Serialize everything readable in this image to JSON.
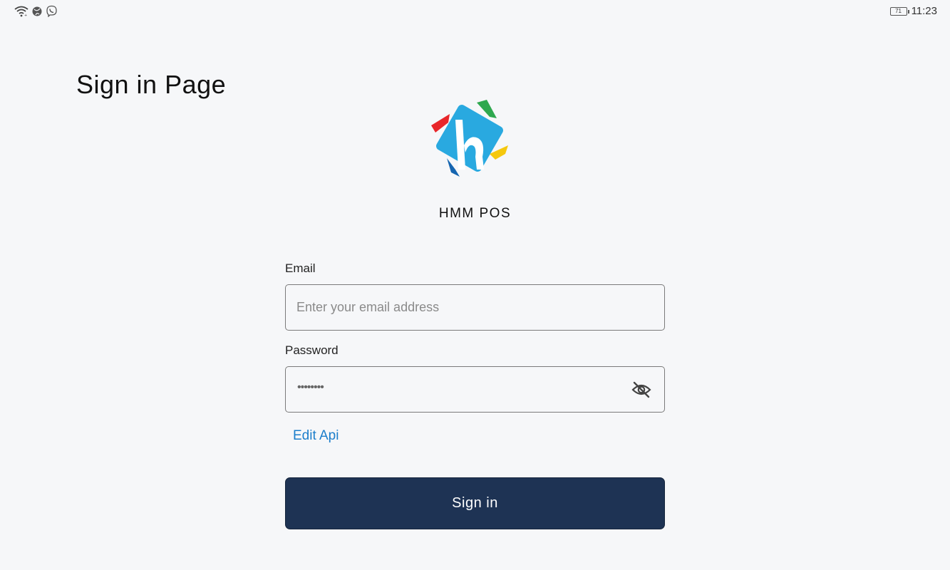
{
  "status_bar": {
    "left_icons": [
      "wifi-icon",
      "globe-icon",
      "viber-icon"
    ],
    "battery_level": "71",
    "time": "11:23"
  },
  "page": {
    "title": "Sign in Page"
  },
  "brand": {
    "logo_icon": "hmm-pos-logo",
    "app_name": "HMM POS",
    "colors": {
      "logo_blue": "#29a9e0",
      "logo_red": "#e8262a",
      "logo_green": "#2fa84f",
      "logo_yellow": "#f5c80e",
      "logo_dark_blue": "#1565b0"
    }
  },
  "form": {
    "email": {
      "label": "Email",
      "placeholder": "Enter your email address",
      "value": ""
    },
    "password": {
      "label": "Password",
      "masked_value": "••••••••",
      "toggle_icon": "eye-off-icon"
    },
    "edit_api_link": "Edit Api",
    "submit_label": "Sign in"
  },
  "colors": {
    "background": "#f6f7f9",
    "primary_button": "#1e3354",
    "link": "#1c7ecb"
  }
}
